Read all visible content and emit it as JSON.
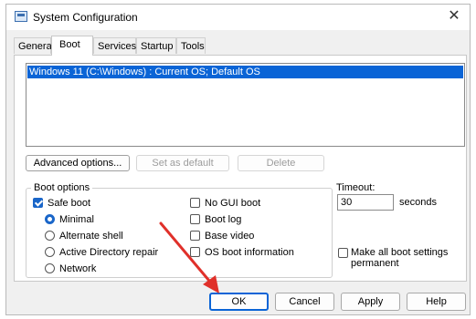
{
  "window": {
    "title": "System Configuration",
    "app_icon": "msconfig-icon",
    "close_glyph": "✕"
  },
  "tabs": [
    {
      "label": "General"
    },
    {
      "label": "Boot"
    },
    {
      "label": "Services"
    },
    {
      "label": "Startup"
    },
    {
      "label": "Tools"
    }
  ],
  "active_tab": "Boot",
  "os_list": {
    "entries": [
      "Windows 11 (C:\\Windows) : Current OS; Default OS"
    ],
    "selected_index": 0
  },
  "os_buttons": {
    "advanced": "Advanced options...",
    "set_default": "Set as default",
    "delete": "Delete"
  },
  "boot_options": {
    "label": "Boot options",
    "safe_boot": {
      "label": "Safe boot",
      "checked": true
    },
    "safe_boot_modes": [
      {
        "label": "Minimal",
        "selected": true
      },
      {
        "label": "Alternate shell",
        "selected": false
      },
      {
        "label": "Active Directory repair",
        "selected": false
      },
      {
        "label": "Network",
        "selected": false
      }
    ],
    "no_gui_boot": {
      "label": "No GUI boot",
      "checked": false
    },
    "boot_log": {
      "label": "Boot log",
      "checked": false
    },
    "base_video": {
      "label": "Base video",
      "checked": false
    },
    "os_boot_information": {
      "label": "OS boot information",
      "checked": false
    }
  },
  "timeout": {
    "label": "Timeout:",
    "value": "30",
    "unit": "seconds"
  },
  "make_permanent": {
    "label_line1": "Make all boot settings",
    "label_line2": "permanent",
    "checked": false
  },
  "footer": {
    "ok": "OK",
    "cancel": "Cancel",
    "apply": "Apply",
    "help": "Help"
  },
  "colors": {
    "accent": "#0a64d6",
    "annotation_arrow": "#e0302a"
  }
}
